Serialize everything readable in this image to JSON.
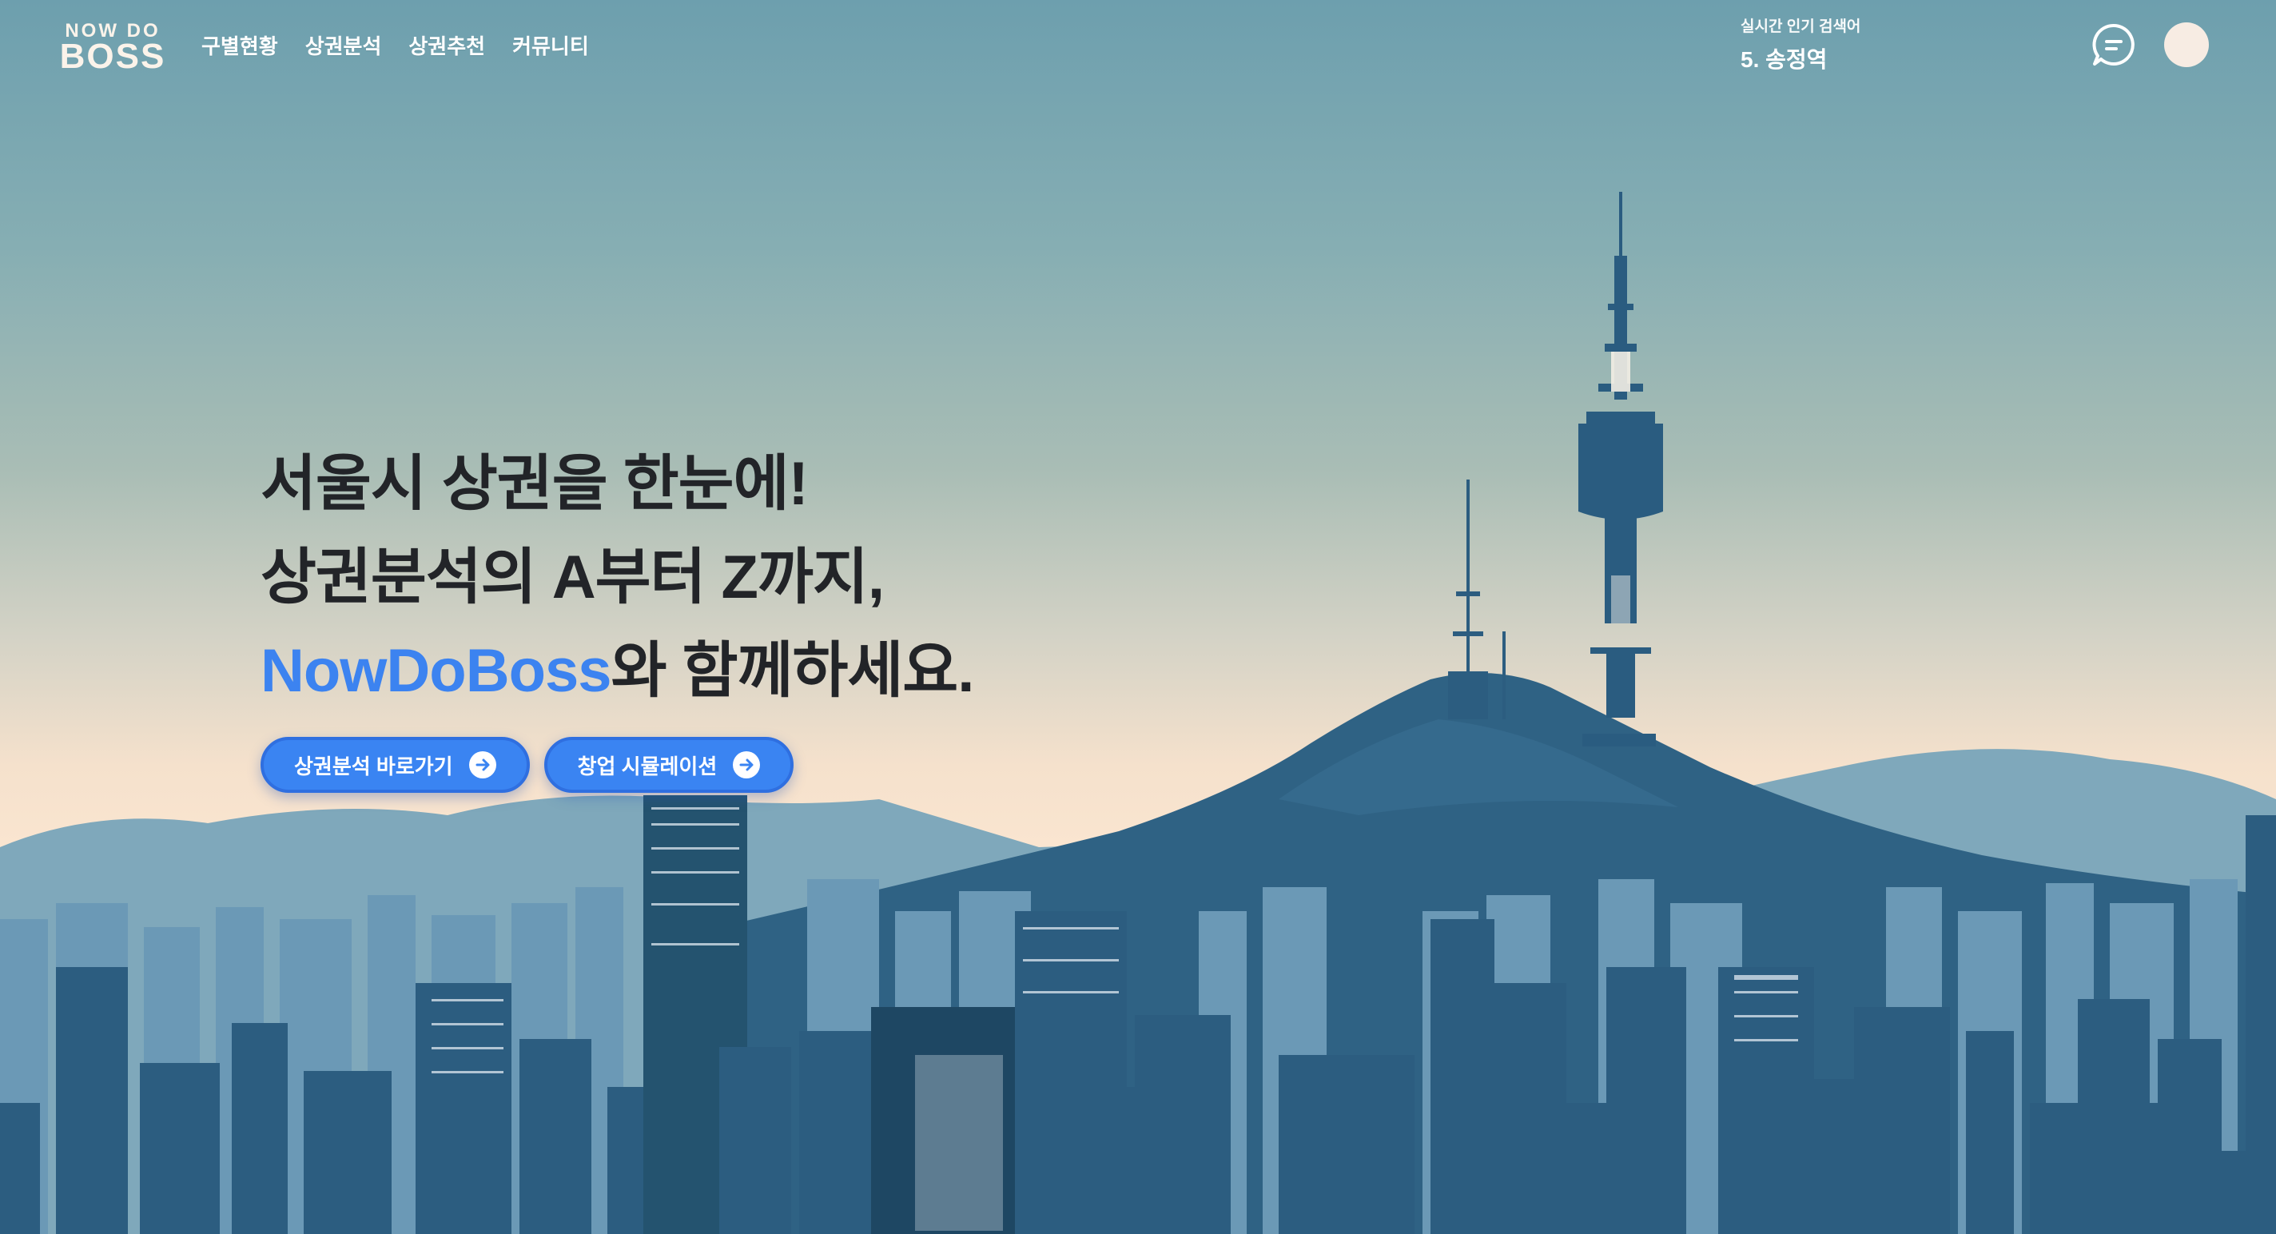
{
  "brand": {
    "logo_top": "NOW DO",
    "logo_bottom": "BOSS"
  },
  "nav": {
    "items": [
      "구별현황",
      "상권분석",
      "상권추천",
      "커뮤니티"
    ]
  },
  "trending": {
    "label": "실시간 인기 검색어",
    "value": "5. 송정역"
  },
  "icons": {
    "chat": "chat-bubble-icon",
    "avatar": "avatar",
    "arrow": "arrow-right-circle-icon"
  },
  "hero": {
    "line1": "서울시 상권을 한눈에!",
    "line2": "상권분석의 A부터 Z까지,",
    "line3_brand": "NowDoBoss",
    "line3_rest": "와 함께하세요.",
    "cta_primary": "상권분석 바로가기",
    "cta_secondary": "창업 시뮬레이션"
  },
  "colors": {
    "accent": "#3a84f2",
    "headline": "#222428",
    "sky_top": "#6d9fae",
    "horizon": "#fbe6d1"
  }
}
